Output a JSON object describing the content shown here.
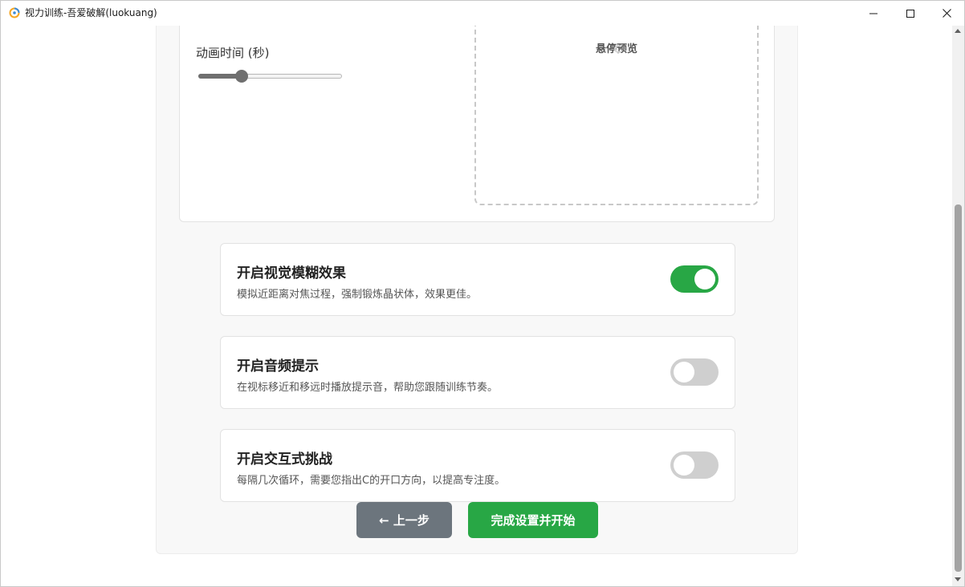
{
  "window": {
    "title": "视力训练-吾爱破解(luokuang)",
    "icon": "app-logo-icon",
    "controls": {
      "minimize_icon": "minimize-icon",
      "maximize_icon": "maximize-icon",
      "close_icon": "close-icon"
    }
  },
  "settings": {
    "animation_time_label": "动画时间 (秒)",
    "animation_slider_fraction": 0.28,
    "preview_label": "悬停预览"
  },
  "options": [
    {
      "title": "开启视觉模糊效果",
      "description": "模拟近距离对焦过程，强制锻炼晶状体，效果更佳。",
      "enabled": true
    },
    {
      "title": "开启音频提示",
      "description": "在视标移近和移远时播放提示音，帮助您跟随训练节奏。",
      "enabled": false
    },
    {
      "title": "开启交互式挑战",
      "description": "每隔几次循环，需要您指出C的开口方向，以提高专注度。",
      "enabled": false
    }
  ],
  "buttons": {
    "back_label": "← 上一步",
    "start_label": "完成设置并开始"
  },
  "colors": {
    "accent_green": "#28a745",
    "secondary_gray": "#6c757d",
    "toggle_off": "#cfcfcf"
  }
}
